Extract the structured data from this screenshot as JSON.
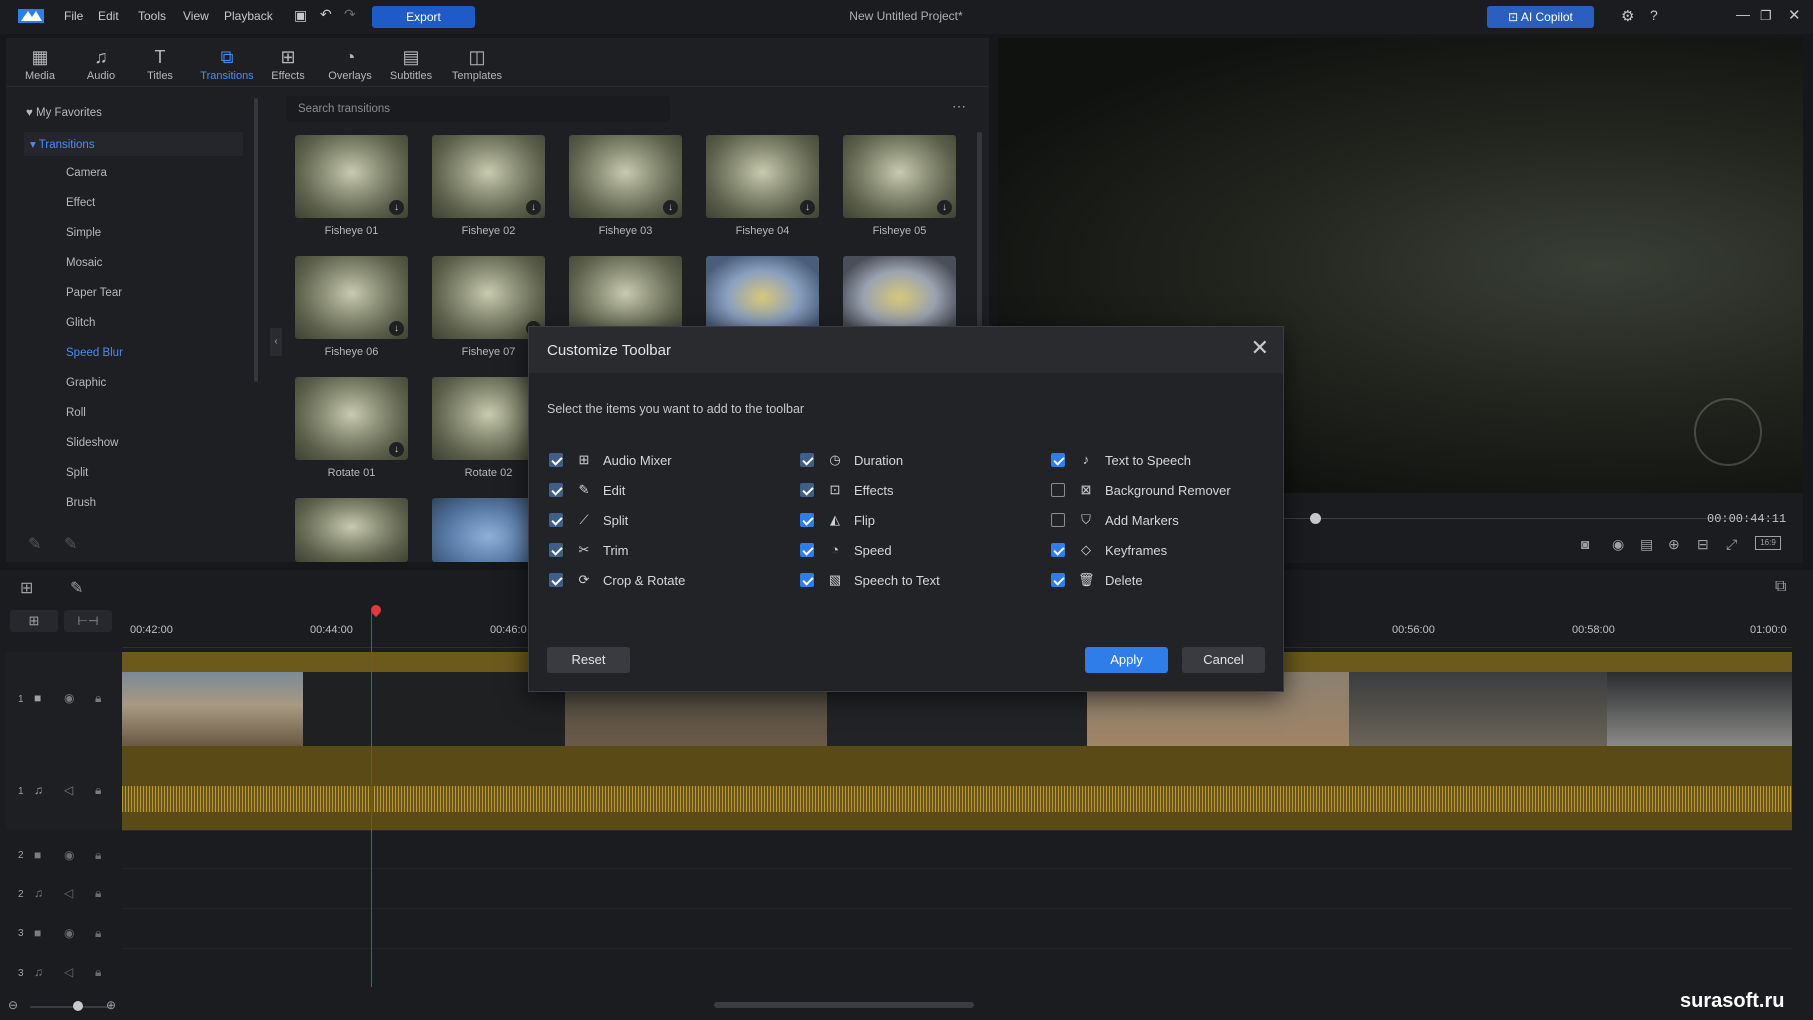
{
  "menu": [
    "File",
    "Edit",
    "Tools",
    "View",
    "Playback"
  ],
  "export_label": "Export",
  "project_title": "New Untitled Project*",
  "ai_label": "AI Copilot",
  "tabs": [
    {
      "label": "Media",
      "icon": "media-icon"
    },
    {
      "label": "Audio",
      "icon": "audio-icon"
    },
    {
      "label": "Titles",
      "icon": "titles-icon"
    },
    {
      "label": "Transitions",
      "icon": "transitions-icon"
    },
    {
      "label": "Effects",
      "icon": "effects-icon"
    },
    {
      "label": "Overlays",
      "icon": "overlays-icon"
    },
    {
      "label": "Subtitles",
      "icon": "subtitles-icon"
    },
    {
      "label": "Templates",
      "icon": "templates-icon"
    }
  ],
  "favorites_label": "My Favorites",
  "transitions_label": "Transitions",
  "categories": [
    "Camera",
    "Effect",
    "Simple",
    "Mosaic",
    "Paper Tear",
    "Glitch",
    "Speed Blur",
    "Graphic",
    "Roll",
    "Slideshow",
    "Split",
    "Brush"
  ],
  "search_placeholder": "Search transitions",
  "thumbs": [
    "Fisheye 01",
    "Fisheye 02",
    "Fisheye 03",
    "Fisheye 04",
    "Fisheye 05",
    "Fisheye 06",
    "Fisheye 07",
    "",
    "",
    "",
    "Rotate 01",
    "Rotate 02",
    "",
    ""
  ],
  "timecode": "00:00:44:11",
  "ruler": [
    "00:42:00",
    "00:44:00",
    "00:46:0",
    "00:56:00",
    "00:58:00",
    "01:00:0"
  ],
  "track_numbers": [
    "1",
    "1",
    "2",
    "2",
    "3",
    "3"
  ],
  "dialog": {
    "title": "Customize Toolbar",
    "subtitle": "Select the items you want to add to the toolbar",
    "columns": [
      [
        {
          "label": "Audio Mixer",
          "icon": "audio-mixer-icon",
          "checked": true
        },
        {
          "label": "Edit",
          "icon": "edit-icon",
          "checked": true
        },
        {
          "label": "Split",
          "icon": "split-icon",
          "checked": true
        },
        {
          "label": "Trim",
          "icon": "trim-icon",
          "checked": true
        },
        {
          "label": "Crop & Rotate",
          "icon": "crop-rotate-icon",
          "checked": true
        }
      ],
      [
        {
          "label": "Duration",
          "icon": "duration-icon",
          "checked": true
        },
        {
          "label": "Effects",
          "icon": "effects-icon",
          "checked": true
        },
        {
          "label": "Flip",
          "icon": "flip-icon",
          "checked": true
        },
        {
          "label": "Speed",
          "icon": "speed-icon",
          "checked": true
        },
        {
          "label": "Speech to Text",
          "icon": "speech-to-text-icon",
          "checked": true
        }
      ],
      [
        {
          "label": "Text to Speech",
          "icon": "text-to-speech-icon",
          "checked": true
        },
        {
          "label": "Background Remover",
          "icon": "background-remover-icon",
          "checked": false
        },
        {
          "label": "Add Markers",
          "icon": "add-markers-icon",
          "checked": false
        },
        {
          "label": "Keyframes",
          "icon": "keyframes-icon",
          "checked": true
        },
        {
          "label": "Delete",
          "icon": "delete-icon",
          "checked": true
        }
      ]
    ],
    "reset_label": "Reset",
    "apply_label": "Apply",
    "cancel_label": "Cancel"
  },
  "watermark": "surasoft.ru"
}
